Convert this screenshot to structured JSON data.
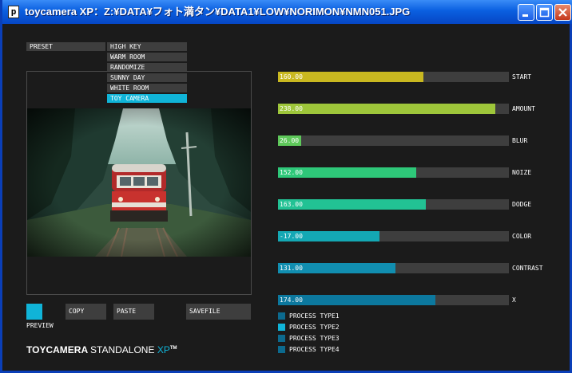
{
  "window": {
    "title": "toycamera XP：Z:¥DATA¥フォト満タン¥DATA1¥LOW¥NORIMON¥NMN051.JPG",
    "app_icon": "p"
  },
  "preset": {
    "label": "PRESET",
    "items": [
      {
        "label": "HIGH KEY",
        "selected": false
      },
      {
        "label": "WARM ROOM",
        "selected": false
      },
      {
        "label": "RANDOMIZE",
        "selected": false
      },
      {
        "label": "SUNNY DAY",
        "selected": false
      },
      {
        "label": "WHITE ROOM",
        "selected": false
      },
      {
        "label": "TOY CAMERA",
        "selected": true
      }
    ]
  },
  "buttons": {
    "preview": "PREVIEW",
    "copy": "COPY",
    "paste": "PASTE",
    "savefile": "SAVEFILE"
  },
  "brand": {
    "bold": "TOYCAMERA",
    "thin": "STANDALONE",
    "xp": "XP",
    "tm": "TM"
  },
  "sliders": [
    {
      "label": "START",
      "value": "160.00",
      "fraction": 0.63,
      "color": "#c9b820"
    },
    {
      "label": "AMOUNT",
      "value": "238.00",
      "fraction": 0.94,
      "color": "#9ec63a"
    },
    {
      "label": "BLUR",
      "value": "26.00",
      "fraction": 0.1,
      "color": "#5ec85a"
    },
    {
      "label": "NOIZE",
      "value": "152.00",
      "fraction": 0.6,
      "color": "#2ec879"
    },
    {
      "label": "DODGE",
      "value": "163.00",
      "fraction": 0.64,
      "color": "#22c294"
    },
    {
      "label": "COLOR",
      "value": "-17.00",
      "fraction": 0.44,
      "color": "#14a8b4"
    },
    {
      "label": "CONTRAST",
      "value": "131.00",
      "fraction": 0.51,
      "color": "#118eb0"
    },
    {
      "label": "X",
      "value": "174.00",
      "fraction": 0.68,
      "color": "#0c789e"
    }
  ],
  "process_types": [
    {
      "label": "PROCESS TYPE1",
      "active": false
    },
    {
      "label": "PROCESS TYPE2",
      "active": true
    },
    {
      "label": "PROCESS TYPE3",
      "active": false
    },
    {
      "label": "PROCESS TYPE4",
      "active": false
    }
  ],
  "colors": {
    "accent": "#10b4d8",
    "panel": "#3e3e3e",
    "background": "#1b1b1b",
    "checkbox_off": "#0c6a8e"
  }
}
